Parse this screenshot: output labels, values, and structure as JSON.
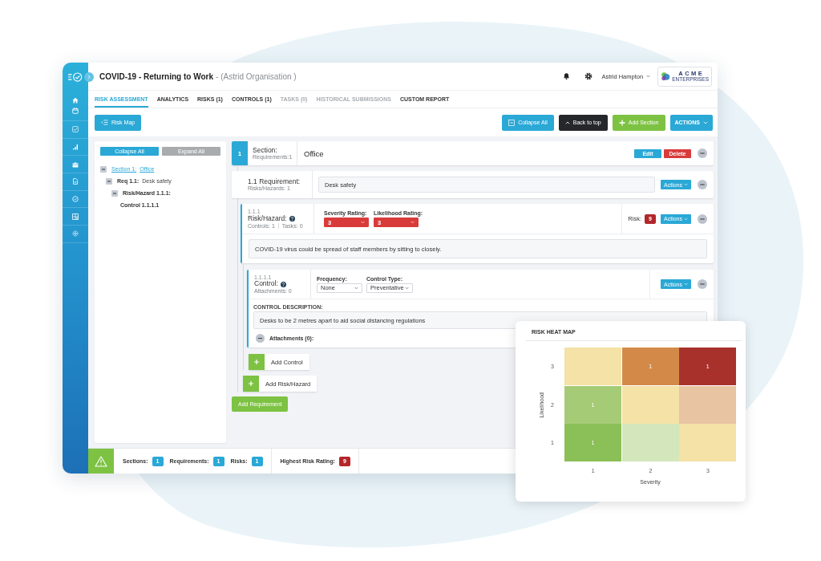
{
  "header": {
    "title": "COVID-19 - Returning to Work",
    "subtitle": "- (Astrid Organisation )",
    "user": "Astrid Hampton",
    "logo": {
      "name": "ACME",
      "tagline": "ENTERPRISES"
    }
  },
  "tabs": [
    {
      "label": "RISK ASSESSMENT",
      "selected": true,
      "disabled": false
    },
    {
      "label": "ANALYTICS",
      "selected": false,
      "disabled": false
    },
    {
      "label": "RISKS (1)",
      "selected": false,
      "disabled": false
    },
    {
      "label": "CONTROLS (1)",
      "selected": false,
      "disabled": false
    },
    {
      "label": "TASKS (0)",
      "selected": false,
      "disabled": true
    },
    {
      "label": "HISTORICAL SUBMISSIONS",
      "selected": false,
      "disabled": true
    },
    {
      "label": "CUSTOM REPORT",
      "selected": false,
      "disabled": false
    }
  ],
  "toolbar": {
    "risk_map": "Risk Map",
    "collapse_all": "Collapse All",
    "back_to_top": "Back to top",
    "add_section": "Add Section",
    "actions": "ACTIONS"
  },
  "tree_panel": {
    "collapse_all": "Collapse All",
    "expand_all": "Expand All",
    "nodes": [
      {
        "kind": "link",
        "label": "Section 1:",
        "value": "Office",
        "expanded": true,
        "children": [
          {
            "kind": "item",
            "label": "Req 1.1:",
            "value": "Desk safety",
            "expanded": true,
            "children": [
              {
                "kind": "item",
                "label": "Risk/Hazard 1.1.1:",
                "expanded": true,
                "children": [
                  {
                    "kind": "item",
                    "label": "Control 1.1.1.1"
                  }
                ]
              }
            ]
          }
        ]
      }
    ]
  },
  "section": {
    "number": "1",
    "label": "Section:",
    "meta": "Requirements:1",
    "name": "Office",
    "edit": "Edit",
    "delete": "Delete"
  },
  "requirement": {
    "label": "1.1 Requirement:",
    "meta": "Risks/Hazards: 1",
    "value": "Desk safety",
    "actions": "Actions"
  },
  "risk": {
    "number": "1.1.1",
    "label": "Risk/Hazard:",
    "meta": [
      "Controls: 1",
      "Tasks: 0"
    ],
    "fields": [
      {
        "label": "Severity Rating:",
        "value": "3",
        "color": "#d93b3b"
      },
      {
        "label": "Likelihood Rating:",
        "value": "3",
        "color": "#d93b3b"
      }
    ],
    "risk_label": "Risk:",
    "risk_value": "9",
    "actions": "Actions",
    "description": "COVID-19 virus could be spread of staff members by sitting to closely."
  },
  "control": {
    "number": "1.1.1.1",
    "label": "Control:",
    "meta": "Attachments: 0",
    "fields": [
      {
        "label": "Frequency:",
        "value": "None"
      },
      {
        "label": "Control Type:",
        "value": "Preventative"
      }
    ],
    "actions": "Actions",
    "description_label": "CONTROL DESCRIPTION:",
    "description": "Desks to be 2 metres apart to aid social distancing regulations",
    "attachments": "Attachments (0):"
  },
  "add_control": "Add Control",
  "add_risk": "Add Risk/Hazard",
  "add_requirement": "Add Requirement",
  "status_bar": {
    "counts": [
      {
        "label": "Sections:",
        "value": "1"
      },
      {
        "label": "Requirements:",
        "value": "1"
      },
      {
        "label": "Risks:",
        "value": "1"
      }
    ],
    "highest_label": "Highest Risk Rating:",
    "highest_value": "9"
  },
  "heat_map": {
    "title": "RISK HEAT MAP",
    "y_label": "Likelihood",
    "x_label": "Severity",
    "x_ticks": [
      "1",
      "2",
      "3"
    ],
    "rows": [
      {
        "tick": "3",
        "cells": [
          {
            "color": "#f4e2a6"
          },
          {
            "color": "#d38a48",
            "count": "1"
          },
          {
            "color": "#a8312c",
            "count": "1"
          }
        ]
      },
      {
        "tick": "2",
        "cells": [
          {
            "color": "#a6cb76",
            "count": "1"
          },
          {
            "color": "#f4e2a6"
          },
          {
            "color": "#e8c4a2"
          }
        ]
      },
      {
        "tick": "1",
        "cells": [
          {
            "color": "#8bbf57",
            "count": "1"
          },
          {
            "color": "#d4e6bb"
          },
          {
            "color": "#f4e2a6"
          }
        ]
      }
    ]
  }
}
